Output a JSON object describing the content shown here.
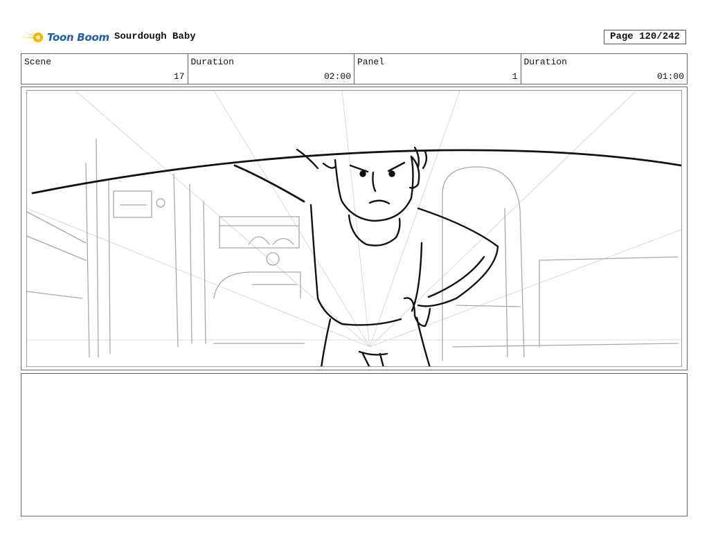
{
  "header": {
    "logo_text": "Toon Boom",
    "project_title": "Sourdough Baby",
    "page": "Page 120/242"
  },
  "info": {
    "scene_label": "Scene",
    "scene_value": "17",
    "scene_duration_label": "Duration",
    "scene_duration_value": "02:00",
    "panel_label": "Panel",
    "panel_value": "1",
    "panel_duration_label": "Duration",
    "panel_duration_value": "01:00"
  },
  "panel": {
    "image": "storyboard-sketch"
  },
  "notes": {
    "text": ""
  },
  "colors": {
    "logo_blue": "#1f5fa8",
    "logo_yellow": "#f4b400",
    "border": "#666666"
  }
}
